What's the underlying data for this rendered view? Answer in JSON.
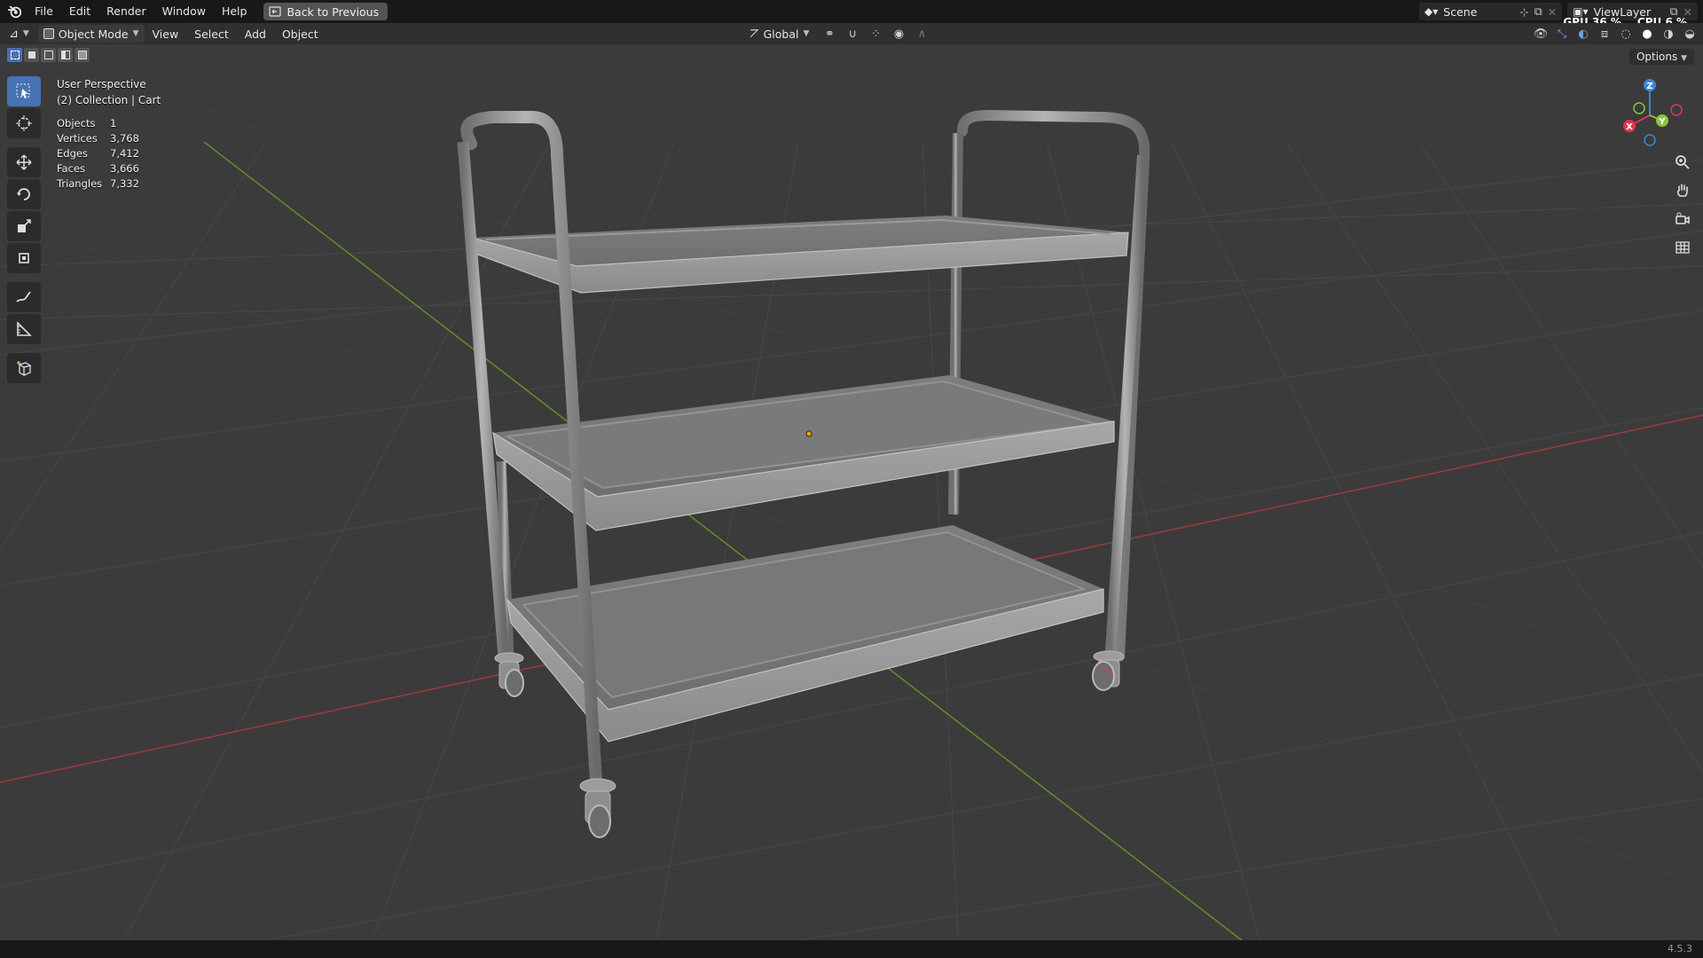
{
  "menu": {
    "items": [
      "File",
      "Edit",
      "Render",
      "Window",
      "Help"
    ],
    "back_button": "Back to Previous"
  },
  "top_right": {
    "scene": "Scene",
    "view_layer": "ViewLayer"
  },
  "perf": {
    "gpu_label": "GPU",
    "gpu_value": "36 %",
    "cpu_label": "CPU",
    "cpu_value": "6 %"
  },
  "header": {
    "mode": "Object Mode",
    "menus": [
      "View",
      "Select",
      "Add",
      "Object"
    ],
    "transform_orientation": "Global",
    "options": "Options"
  },
  "overlay": {
    "view_name": "User Perspective",
    "collection": "(2) Collection | Cart"
  },
  "stats": [
    {
      "label": "Objects",
      "value": "1"
    },
    {
      "label": "Vertices",
      "value": "3,768"
    },
    {
      "label": "Edges",
      "value": "7,412"
    },
    {
      "label": "Faces",
      "value": "3,666"
    },
    {
      "label": "Triangles",
      "value": "7,332"
    }
  ],
  "gizmo": {
    "x": "X",
    "y": "Y",
    "z": "Z",
    "x_color": "#e0364f",
    "y_color": "#8ac63b",
    "z_color": "#3b87d9"
  },
  "status": {
    "version": "4.5.3"
  },
  "colors": {
    "accent": "#4772b3",
    "x_axis": "#b3353d",
    "y_axis": "#6c9a2a"
  }
}
